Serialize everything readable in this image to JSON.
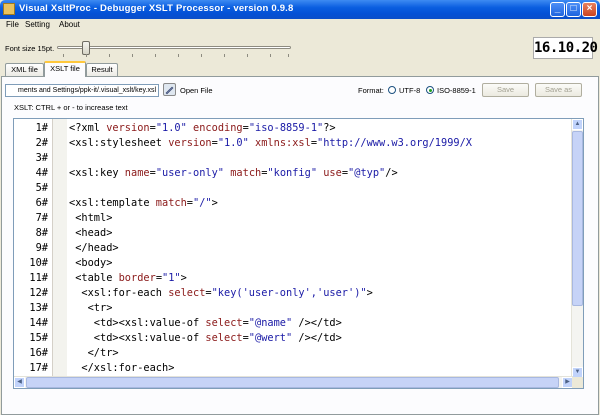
{
  "window": {
    "title": "Visual XsltProc - Debugger XSLT Processor - version 0.9.8"
  },
  "menu": [
    "File",
    "Setting",
    "About"
  ],
  "toolbar": {
    "font_size_label": "Font size 15pt.",
    "font_size_level": 0.12,
    "clock": "16.10.20"
  },
  "tabs": [
    {
      "label": "XML file",
      "active": false
    },
    {
      "label": "XSLT file",
      "active": true
    },
    {
      "label": "Result",
      "active": false
    }
  ],
  "file_row": {
    "path": "ments and Settings/ppk-it/.visual_xslt/key.xsl",
    "open_label": "Open File",
    "format_label": "Format:",
    "formats": [
      {
        "label": "UTF-8",
        "selected": false
      },
      {
        "label": "ISO-8859-1",
        "selected": true
      }
    ],
    "save_label": "Save",
    "save_as_label": "Save as"
  },
  "hint": "XSLT:  CTRL + or - to increase text",
  "colors": {
    "tag": "#000000",
    "attribute": "#8b1a1a",
    "value": "#1a1aa6",
    "titlebar": "#0a5ee0"
  },
  "editor": {
    "line_numbers": [
      "1#",
      "2#",
      "3#",
      "4#",
      "5#",
      "6#",
      "7#",
      "8#",
      "9#",
      "10#",
      "11#",
      "12#",
      "13#",
      "14#",
      "15#",
      "16#",
      "17#",
      "18#"
    ],
    "lines": [
      [
        {
          "t": "t",
          "v": "<?xml "
        },
        {
          "t": "k",
          "v": "version"
        },
        {
          "t": "t",
          "v": "="
        },
        {
          "t": "s",
          "v": "\"1.0\""
        },
        {
          "t": "t",
          "v": " "
        },
        {
          "t": "k",
          "v": "encoding"
        },
        {
          "t": "t",
          "v": "="
        },
        {
          "t": "s",
          "v": "\"iso-8859-1\""
        },
        {
          "t": "t",
          "v": "?>"
        }
      ],
      [
        {
          "t": "t",
          "v": "<xsl:stylesheet "
        },
        {
          "t": "k",
          "v": "version"
        },
        {
          "t": "t",
          "v": "="
        },
        {
          "t": "s",
          "v": "\"1.0\""
        },
        {
          "t": "t",
          "v": " "
        },
        {
          "t": "k",
          "v": "xmlns:xsl"
        },
        {
          "t": "t",
          "v": "="
        },
        {
          "t": "s",
          "v": "\"http://www.w3.org/1999/X"
        }
      ],
      [],
      [
        {
          "t": "t",
          "v": "<xsl:key "
        },
        {
          "t": "k",
          "v": "name"
        },
        {
          "t": "t",
          "v": "="
        },
        {
          "t": "s",
          "v": "\"user-only\""
        },
        {
          "t": "t",
          "v": " "
        },
        {
          "t": "k",
          "v": "match"
        },
        {
          "t": "t",
          "v": "="
        },
        {
          "t": "s",
          "v": "\"konfig\""
        },
        {
          "t": "t",
          "v": " "
        },
        {
          "t": "k",
          "v": "use"
        },
        {
          "t": "t",
          "v": "="
        },
        {
          "t": "s",
          "v": "\"@typ\""
        },
        {
          "t": "t",
          "v": "/>"
        }
      ],
      [],
      [
        {
          "t": "t",
          "v": "<xsl:template "
        },
        {
          "t": "k",
          "v": "match"
        },
        {
          "t": "t",
          "v": "="
        },
        {
          "t": "s",
          "v": "\"/\""
        },
        {
          "t": "t",
          "v": ">"
        }
      ],
      [
        {
          "t": "t",
          "v": " <html>"
        }
      ],
      [
        {
          "t": "t",
          "v": " <head>"
        }
      ],
      [
        {
          "t": "t",
          "v": " </head>"
        }
      ],
      [
        {
          "t": "t",
          "v": " <body>"
        }
      ],
      [
        {
          "t": "t",
          "v": " <table "
        },
        {
          "t": "k",
          "v": "border"
        },
        {
          "t": "t",
          "v": "="
        },
        {
          "t": "s",
          "v": "\"1\""
        },
        {
          "t": "t",
          "v": ">"
        }
      ],
      [
        {
          "t": "t",
          "v": "  <xsl:for-each "
        },
        {
          "t": "k",
          "v": "select"
        },
        {
          "t": "t",
          "v": "="
        },
        {
          "t": "s",
          "v": "\"key('user-only','user')\""
        },
        {
          "t": "t",
          "v": ">"
        }
      ],
      [
        {
          "t": "t",
          "v": "   <tr>"
        }
      ],
      [
        {
          "t": "t",
          "v": "    <td><xsl:value-of "
        },
        {
          "t": "k",
          "v": "select"
        },
        {
          "t": "t",
          "v": "="
        },
        {
          "t": "s",
          "v": "\"@name\""
        },
        {
          "t": "t",
          "v": " /></td>"
        }
      ],
      [
        {
          "t": "t",
          "v": "    <td><xsl:value-of "
        },
        {
          "t": "k",
          "v": "select"
        },
        {
          "t": "t",
          "v": "="
        },
        {
          "t": "s",
          "v": "\"@wert\""
        },
        {
          "t": "t",
          "v": " /></td>"
        }
      ],
      [
        {
          "t": "t",
          "v": "   </tr>"
        }
      ],
      [
        {
          "t": "t",
          "v": "  </xsl:for-each>"
        }
      ],
      [
        {
          "t": "t",
          "v": " </table>"
        }
      ]
    ]
  }
}
